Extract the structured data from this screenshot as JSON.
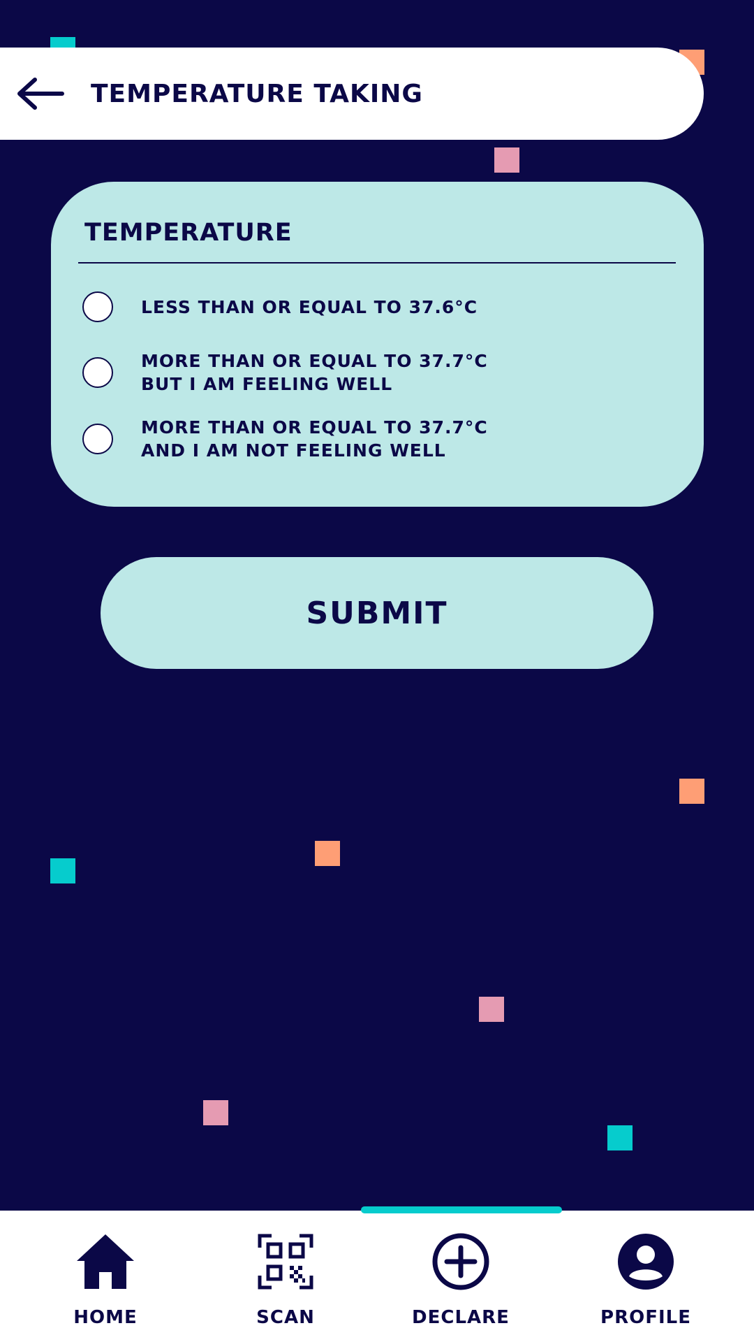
{
  "header": {
    "title": "TEMPERATURE TAKING",
    "back_icon": "arrow-left-icon"
  },
  "card": {
    "title": "TEMPERATURE",
    "options": [
      {
        "lines": [
          "LESS THAN OR EQUAL TO 37.6°C"
        ],
        "selected": false
      },
      {
        "lines": [
          "MORE THAN OR EQUAL TO 37.7°C",
          "BUT I AM FEELING WELL"
        ],
        "selected": false
      },
      {
        "lines": [
          "MORE THAN OR EQUAL TO 37.7°C",
          "AND I AM NOT FEELING WELL"
        ],
        "selected": false
      }
    ]
  },
  "submit": {
    "label": "SUBMIT"
  },
  "nav": {
    "active_index": 2,
    "items": [
      {
        "label": "HOME",
        "icon": "home-icon"
      },
      {
        "label": "SCAN",
        "icon": "qr-scan-icon"
      },
      {
        "label": "DECLARE",
        "icon": "plus-circle-icon"
      },
      {
        "label": "PROFILE",
        "icon": "profile-icon"
      }
    ]
  },
  "colors": {
    "background": "#0b0847",
    "card": "#bde8e7",
    "accent_cyan": "#06cccd",
    "accent_orange": "#fe9e75",
    "accent_pink": "#e59bb2",
    "surface": "#ffffff"
  }
}
